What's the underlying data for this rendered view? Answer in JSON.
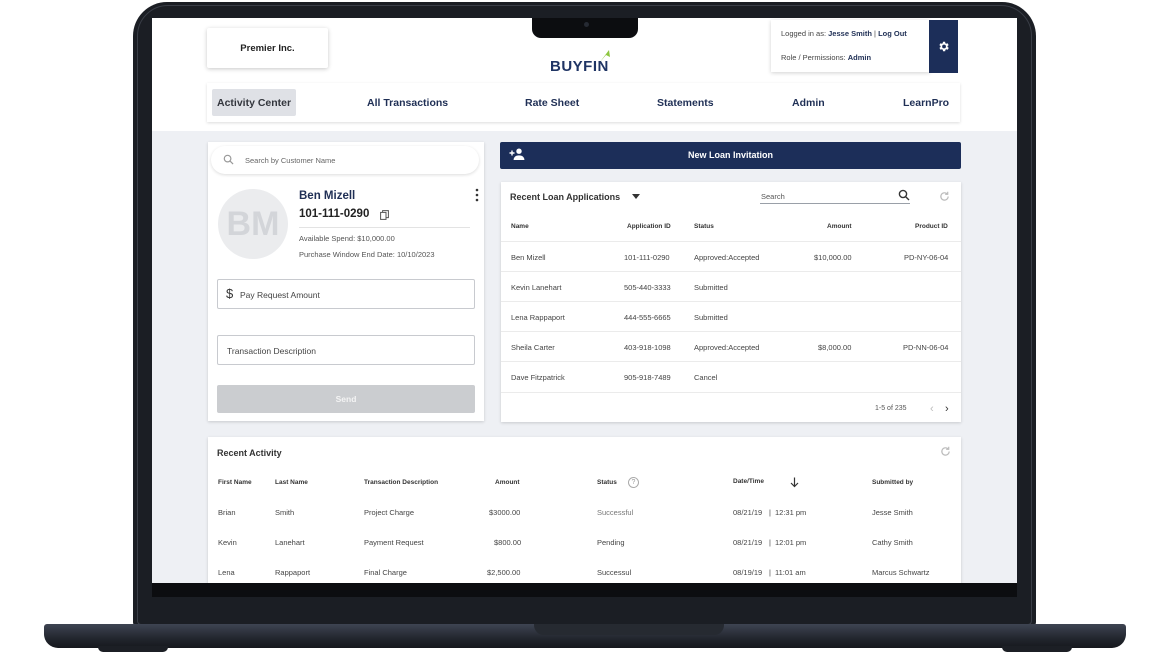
{
  "company": {
    "name": "Premier Inc."
  },
  "logo": {
    "text": "BUYFIN"
  },
  "user": {
    "logged_in_label": "Logged in as:",
    "name": "Jesse Smith",
    "separator": "|",
    "logout_label": "Log Out",
    "role_label": "Role / Permissions:",
    "role": "Admin"
  },
  "nav": {
    "items": [
      {
        "label": "Activity Center",
        "active": true
      },
      {
        "label": "All Transactions"
      },
      {
        "label": "Rate Sheet"
      },
      {
        "label": "Statements"
      },
      {
        "label": "Admin"
      },
      {
        "label": "LearnPro"
      }
    ]
  },
  "customer": {
    "search_placeholder": "Search by Customer Name",
    "initials": "BM",
    "name": "Ben Mizell",
    "phone": "101-111-0290",
    "available_spend": "Available Spend: $10,000.00",
    "window_end": "Purchase Window End Date: 10/10/2023",
    "pay_amount_placeholder": "Pay Request Amount",
    "currency_symbol": "$",
    "description_placeholder": "Transaction Description",
    "send_label": "Send"
  },
  "new_loan": {
    "label": "New Loan Invitation"
  },
  "loans": {
    "title": "Recent Loan Applications",
    "search_placeholder": "Search",
    "columns": {
      "name": "Name",
      "app_id": "Application ID",
      "status": "Status",
      "amount": "Amount",
      "product_id": "Product ID"
    },
    "rows": [
      {
        "name": "Ben Mizell",
        "app_id": "101-111-0290",
        "status": "Approved:Accepted",
        "amount": "$10,000.00",
        "product_id": "PD-NY-06-04"
      },
      {
        "name": "Kevin Lanehart",
        "app_id": "505-440-3333",
        "status": "Submitted",
        "amount": "",
        "product_id": ""
      },
      {
        "name": "Lena Rappaport",
        "app_id": "444-555-6665",
        "status": "Submitted",
        "amount": "",
        "product_id": ""
      },
      {
        "name": "Sheila Carter",
        "app_id": "403-918-1098",
        "status": "Approved:Accepted",
        "amount": "$8,000.00",
        "product_id": "PD-NN-06-04"
      },
      {
        "name": "Dave Fitzpatrick",
        "app_id": "905-918-7489",
        "status": "Cancel",
        "amount": "",
        "product_id": ""
      }
    ],
    "pagination": "1-5 of 235"
  },
  "activity": {
    "title": "Recent Activity",
    "columns": {
      "first_name": "First Name",
      "last_name": "Last Name",
      "description": "Transaction Description",
      "amount": "Amount",
      "status": "Status",
      "datetime": "Date/Time",
      "submitted_by": "Submitted by"
    },
    "rows": [
      {
        "first_name": "Brian",
        "last_name": "Smith",
        "description": "Project Charge",
        "amount": "$3000.00",
        "status": "Successful",
        "date": "08/21/19",
        "sep": "|",
        "time": "12:31 pm",
        "submitted_by": "Jesse Smith"
      },
      {
        "first_name": "Kevin",
        "last_name": "Lanehart",
        "description": "Payment Request",
        "amount": "$800.00",
        "status": "Pending",
        "date": "08/21/19",
        "sep": "|",
        "time": "12:01 pm",
        "submitted_by": "Cathy  Smith"
      },
      {
        "first_name": "Lena",
        "last_name": "Rappaport",
        "description": "Final Charge",
        "amount": "$2,500.00",
        "status": "Successul",
        "date": "08/19/19",
        "sep": "|",
        "time": "11:01 am",
        "submitted_by": "Marcus Schwartz"
      }
    ]
  },
  "colors": {
    "primary": "#1c2e59",
    "accent_green": "#8dc63f",
    "screen_bg": "#eef0f4"
  },
  "icons": [
    "gear-icon",
    "search-icon",
    "copy-icon",
    "kebab-menu-icon",
    "dollar-icon",
    "add-person-icon",
    "caret-down-icon",
    "refresh-icon",
    "chevron-left-icon",
    "chevron-right-icon",
    "help-icon",
    "arrow-down-icon"
  ]
}
